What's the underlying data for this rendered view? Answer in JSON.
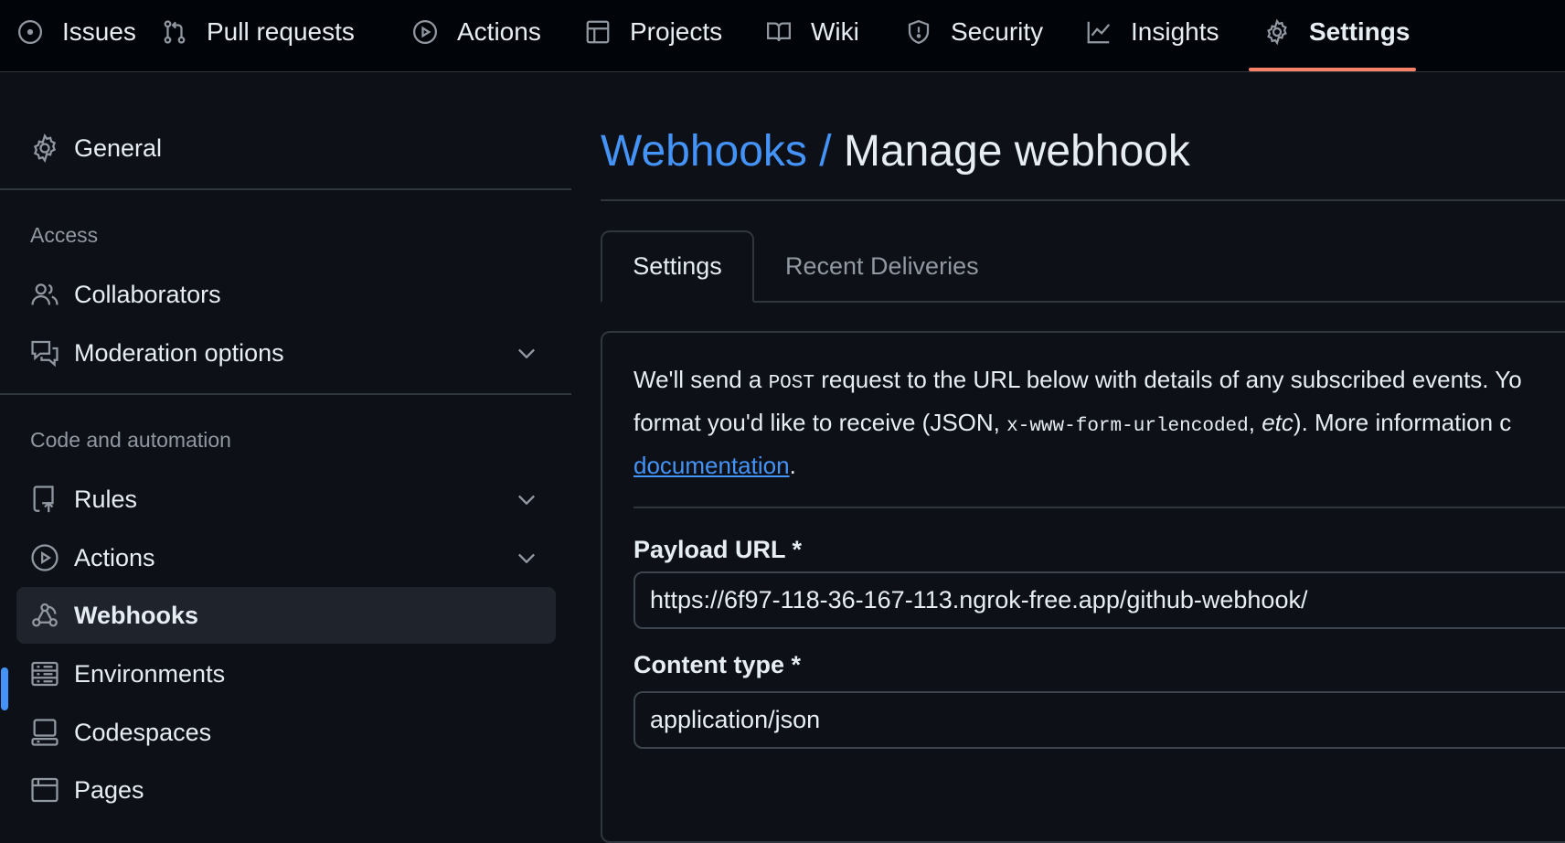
{
  "topnav": {
    "items": [
      {
        "label": "Issues",
        "icon": "issue-opened-icon"
      },
      {
        "label": "Pull requests",
        "icon": "git-pull-request-icon"
      },
      {
        "label": "Actions",
        "icon": "play-icon"
      },
      {
        "label": "Projects",
        "icon": "table-icon"
      },
      {
        "label": "Wiki",
        "icon": "book-icon"
      },
      {
        "label": "Security",
        "icon": "shield-icon"
      },
      {
        "label": "Insights",
        "icon": "graph-icon"
      },
      {
        "label": "Settings",
        "icon": "gear-icon",
        "active": true
      }
    ],
    "active_underline_color": "#f78166"
  },
  "sidebar": {
    "general": "General",
    "access_heading": "Access",
    "collaborators": "Collaborators",
    "moderation": "Moderation options",
    "code_heading": "Code and automation",
    "rules": "Rules",
    "actions": "Actions",
    "webhooks": "Webhooks",
    "environments": "Environments",
    "codespaces": "Codespaces",
    "pages": "Pages",
    "selected": "Webhooks",
    "selected_indicator_color": "#4493f8"
  },
  "main": {
    "breadcrumb_parent": "Webhooks",
    "breadcrumb_sep": "/",
    "breadcrumb_current": "Manage webhook",
    "tabs": [
      "Settings",
      "Recent Deliveries"
    ],
    "intro": {
      "p1": "We'll send a ",
      "post": "POST",
      "p2": " request to the URL below with details of any subscribed events. Yo",
      "p3": "format you'd like to receive (JSON, ",
      "urlencoded": "x-www-form-urlencoded",
      "p4": ", ",
      "etc": "etc",
      "p5": "). More information c",
      "link": "documentation",
      "end": "."
    },
    "payload_label": "Payload URL *",
    "payload_value": "https://6f97-118-36-167-113.ngrok-free.app/github-webhook/",
    "content_type_label": "Content type *",
    "content_type_value": "application/json"
  }
}
